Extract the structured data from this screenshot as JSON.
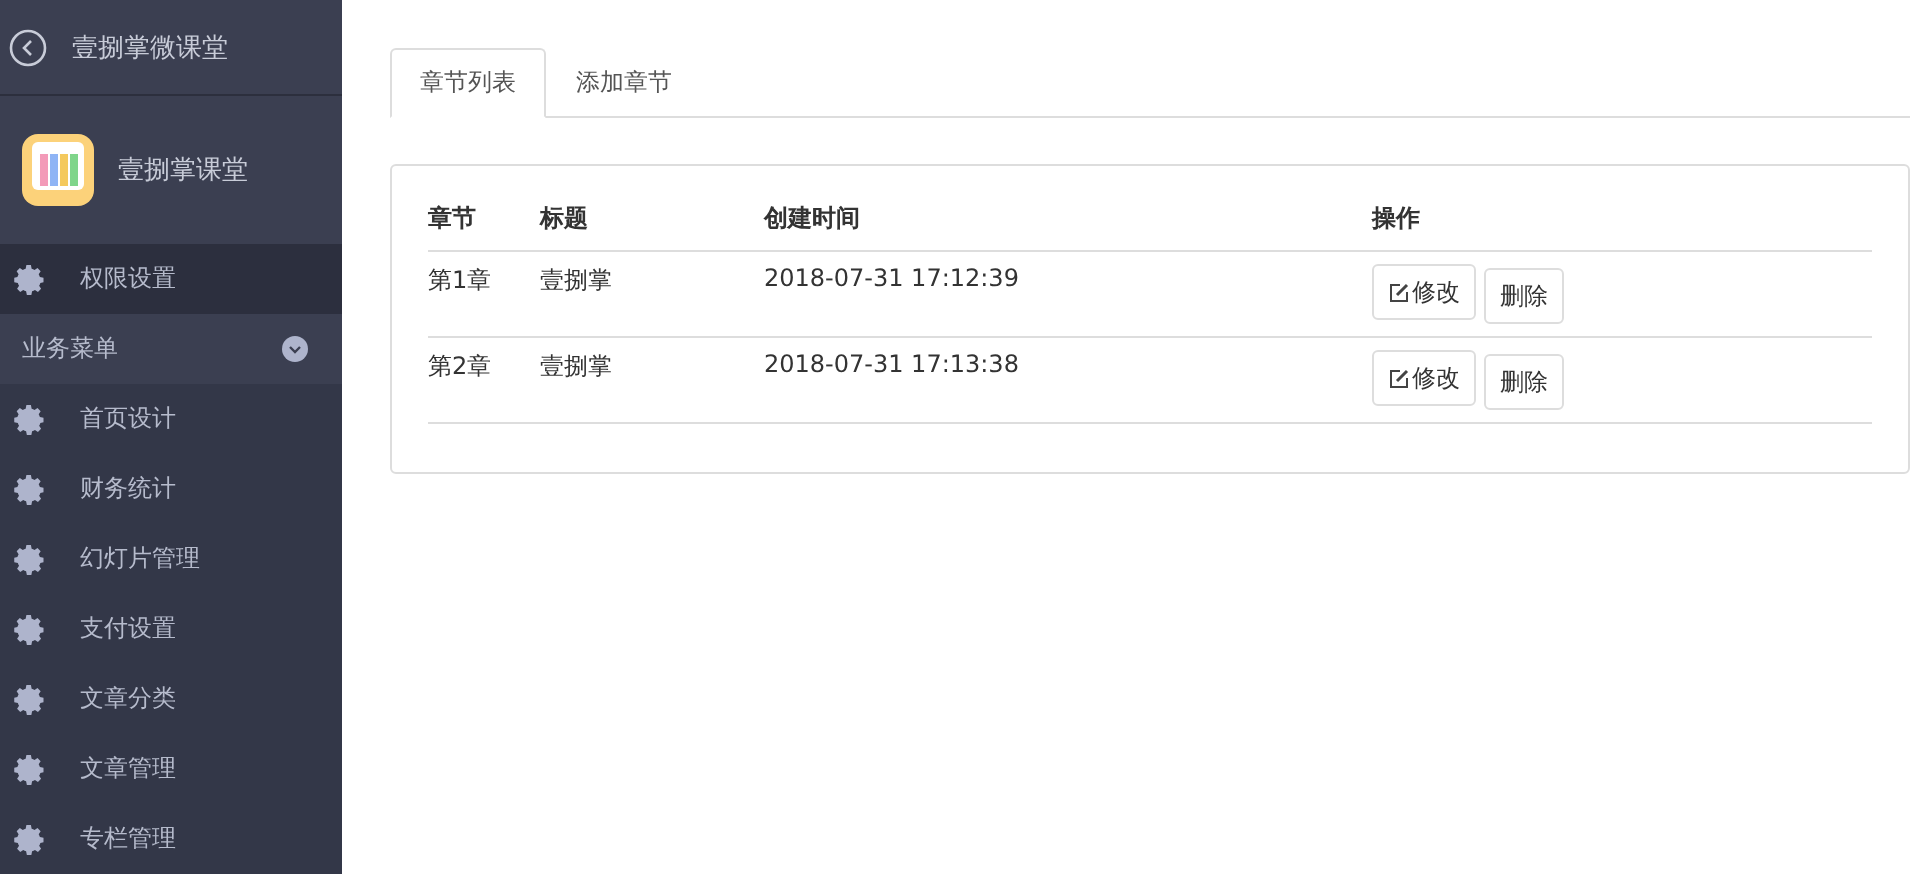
{
  "sidebar": {
    "header": {
      "title": "壹捌掌微课堂"
    },
    "profile": {
      "name": "壹捌掌课堂"
    },
    "top_item": {
      "label": "权限设置"
    },
    "section": {
      "label": "业务菜单",
      "expanded": true
    },
    "items": [
      {
        "label": "首页设计"
      },
      {
        "label": "财务统计"
      },
      {
        "label": "幻灯片管理"
      },
      {
        "label": "支付设置"
      },
      {
        "label": "文章分类"
      },
      {
        "label": "文章管理"
      },
      {
        "label": "专栏管理"
      }
    ]
  },
  "tabs": [
    {
      "label": "章节列表",
      "selected": true
    },
    {
      "label": "添加章节",
      "selected": false
    }
  ],
  "table": {
    "columns": [
      "章节",
      "标题",
      "创建时间",
      "操作"
    ],
    "rows": [
      {
        "chapter": "第1章",
        "title": "壹捌掌",
        "created": "2018-07-31 17:12:39",
        "actions": [
          "修改",
          "删除"
        ]
      },
      {
        "chapter": "第2章",
        "title": "壹捌掌",
        "created": "2018-07-31 17:13:38",
        "actions": [
          "修改",
          "删除"
        ]
      }
    ]
  }
}
